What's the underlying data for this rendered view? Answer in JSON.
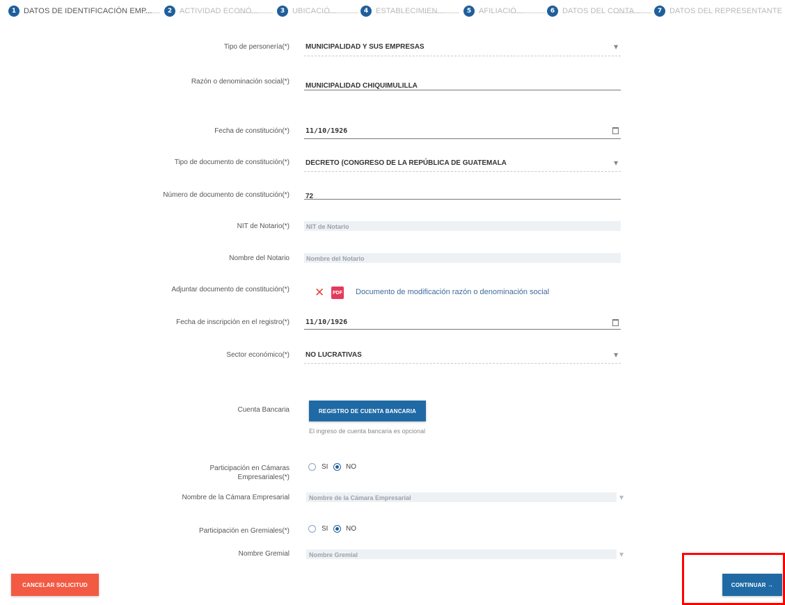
{
  "stepper": [
    {
      "num": "1",
      "label": "DATOS DE IDENTIFICACIÓN EMP..."
    },
    {
      "num": "2",
      "label": "ACTIVIDAD ECONÓ..."
    },
    {
      "num": "3",
      "label": "UBICACIÓ..."
    },
    {
      "num": "4",
      "label": "ESTABLECIMIEN..."
    },
    {
      "num": "5",
      "label": "AFILIACIÓ..."
    },
    {
      "num": "6",
      "label": "DATOS DEL CONTA..."
    },
    {
      "num": "7",
      "label": "DATOS DEL REPRESENTANTE L..."
    }
  ],
  "form": {
    "tipo_personeria": {
      "label": "Tipo de personería(*)",
      "value": "MUNICIPALIDAD Y SUS EMPRESAS"
    },
    "razon_social": {
      "label": "Razón o denominación social(*)",
      "value": "MUNICIPALIDAD CHIQUIMULILLA"
    },
    "fecha_constitucion": {
      "label": "Fecha de constitución(*)",
      "value": "11/10/1926"
    },
    "tipo_documento": {
      "label": "Tipo de documento de constitución(*)",
      "value": "DECRETO (CONGRESO DE LA REPÚBLICA DE GUATEMALA"
    },
    "numero_documento": {
      "label": "Número de documento de constitución(*)",
      "value": "72"
    },
    "nit_notario": {
      "label": "NIT de Notario(*)",
      "placeholder": "NIT de Notario"
    },
    "nombre_notario": {
      "label": "Nombre del Notario",
      "placeholder": "Nombre del Notario"
    },
    "adjuntar": {
      "label": "Adjuntar documento de constitución(*)",
      "pdf_text": "PDF",
      "link": "Documento de modificación razón o denominación social"
    },
    "fecha_inscripcion": {
      "label": "Fecha de inscripción en el registro(*)",
      "value": "11/10/1926"
    },
    "sector": {
      "label": "Sector económico(*)",
      "value": "NO LUCRATIVAS"
    },
    "cuenta": {
      "label": "Cuenta Bancaria",
      "button": "REGISTRO DE CUENTA BANCARIA",
      "hint": "El ingreso de cuenta bancaria es opcional"
    },
    "camaras": {
      "label_line1": "Participación en Cámaras",
      "label_line2": "Empresariales(*)",
      "opt_si": "SI",
      "opt_no": "NO",
      "selected": "NO"
    },
    "nombre_camara": {
      "label": "Nombre de la Cámara Empresarial",
      "placeholder": "Nombre de la Cámara Empresarial"
    },
    "gremiales": {
      "label": "Participación en Gremiales(*)",
      "opt_si": "SI",
      "opt_no": "NO",
      "selected": "NO"
    },
    "nombre_gremial": {
      "label": "Nombre Gremial",
      "placeholder": "Nombre Gremial"
    }
  },
  "footer": {
    "cancel": "CANCELAR SOLICITUD",
    "continue": "CONTINUAR →"
  },
  "colors": {
    "primary": "#1f6aa5",
    "danger": "#f25a43",
    "highlight": "#ff0000"
  }
}
